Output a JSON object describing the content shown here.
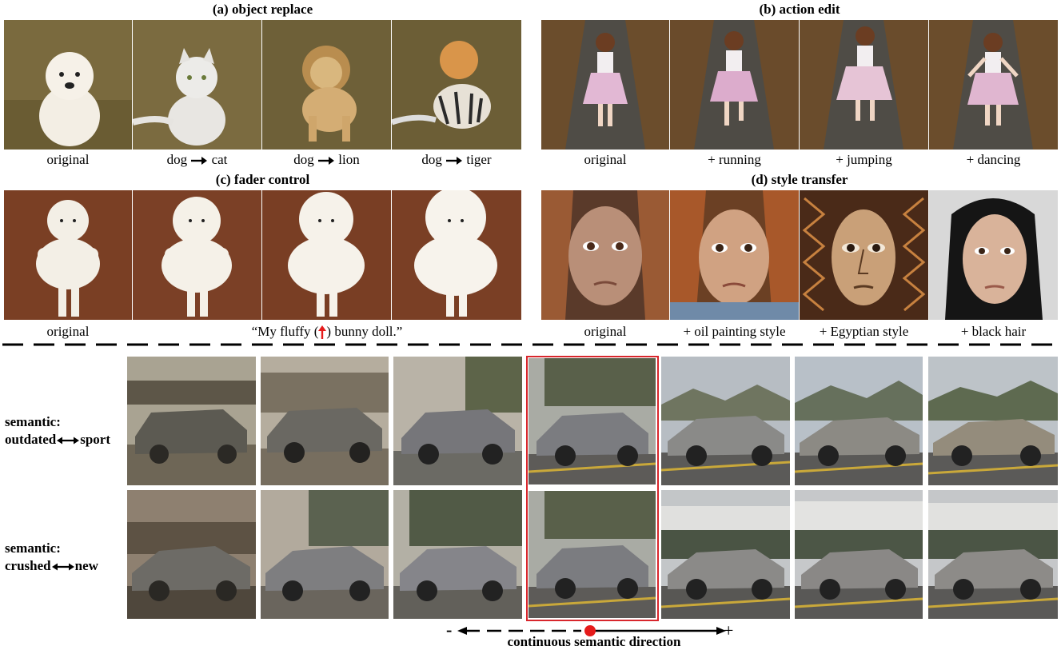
{
  "panels": {
    "a": {
      "title": "(a) object replace",
      "captions": [
        "original",
        "dog",
        "cat",
        "dog",
        "lion",
        "dog",
        "tiger"
      ]
    },
    "b": {
      "title": "(b) action edit",
      "captions": [
        "original",
        "+ running",
        "+ jumping",
        "+ dancing"
      ]
    },
    "c": {
      "title": "(c) fader control",
      "captions": [
        "original",
        "“My fluffy (",
        ") bunny doll.”"
      ]
    },
    "d": {
      "title": "(d) style transfer",
      "captions": [
        "original",
        "+ oil painting style",
        "+ Egyptian style",
        "+ black hair"
      ]
    }
  },
  "semantic_rows": [
    {
      "line1": "semantic:",
      "left": "outdated",
      "right": "sport"
    },
    {
      "line1": "semantic:",
      "left": "crushed",
      "right": "new"
    }
  ],
  "axis": {
    "minus": "-",
    "plus": "+",
    "label": "continuous semantic direction"
  },
  "colors": {
    "highlight": "#d8262c",
    "dot": "#e51b1b",
    "fader_arrow": "#e51b1b"
  },
  "icons": [
    "right-arrow-icon",
    "up-arrow-icon",
    "double-arrow-icon"
  ]
}
